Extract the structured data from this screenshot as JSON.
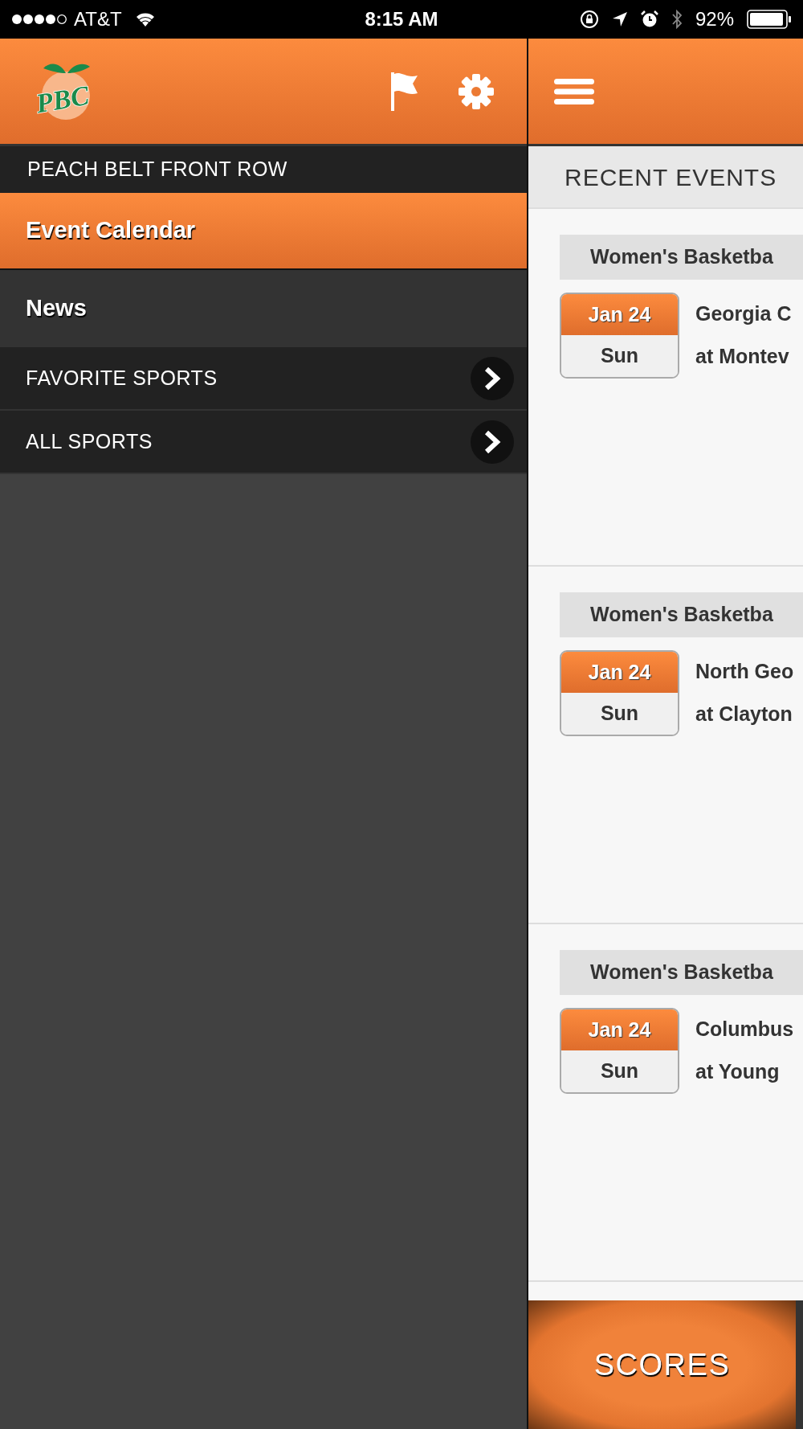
{
  "status_bar": {
    "carrier": "AT&T",
    "time": "8:15 AM",
    "battery": "92%"
  },
  "logo": {
    "text": "PBC"
  },
  "menu": {
    "title": "PEACH BELT FRONT ROW",
    "items": [
      {
        "label": "Event Calendar",
        "kind": "link",
        "selected": true
      },
      {
        "label": "News",
        "kind": "link",
        "selected": false
      },
      {
        "label": "FAVORITE SPORTS",
        "kind": "section",
        "selected": false
      },
      {
        "label": "ALL SPORTS",
        "kind": "section",
        "selected": false
      }
    ]
  },
  "main": {
    "title": "RECENT EVENTS",
    "events": [
      {
        "category": "Women's Basketba",
        "date": "Jan 24",
        "weekday": "Sun",
        "matchup": "Georgia C",
        "venue": "at Montev"
      },
      {
        "category": "Women's Basketba",
        "date": "Jan 24",
        "weekday": "Sun",
        "matchup": "North Geo",
        "venue": "at Clayton"
      },
      {
        "category": "Women's Basketba",
        "date": "Jan 24",
        "weekday": "Sun",
        "matchup": "Columbus",
        "venue": "at Young"
      }
    ]
  },
  "tab_bar": {
    "tabs": [
      {
        "label": "SCORES"
      }
    ]
  }
}
